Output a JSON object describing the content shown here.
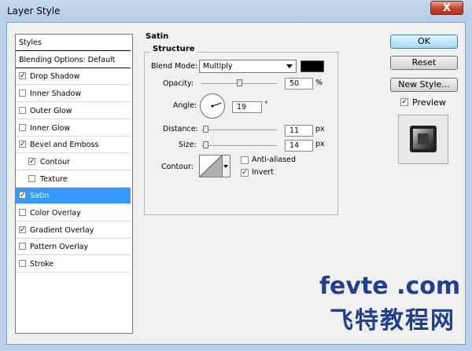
{
  "window": {
    "title": "Layer Style",
    "close_glyph": "X"
  },
  "styles_list": [
    {
      "label": "Styles",
      "type": "header"
    },
    {
      "label": "Blending Options: Default",
      "type": "header"
    },
    {
      "label": "Drop Shadow",
      "checked": true
    },
    {
      "label": "Inner Shadow",
      "checked": false
    },
    {
      "label": "Outer Glow",
      "checked": false
    },
    {
      "label": "Inner Glow",
      "checked": false
    },
    {
      "label": "Bevel and Emboss",
      "checked": true
    },
    {
      "label": "Contour",
      "checked": true,
      "indent": true
    },
    {
      "label": "Texture",
      "checked": false,
      "indent": true
    },
    {
      "label": "Satin",
      "checked": true,
      "selected": true
    },
    {
      "label": "Color Overlay",
      "checked": false
    },
    {
      "label": "Gradient Overlay",
      "checked": true
    },
    {
      "label": "Pattern Overlay",
      "checked": false
    },
    {
      "label": "Stroke",
      "checked": false
    }
  ],
  "panel": {
    "section_title": "Satin",
    "group_title": "Structure",
    "blend_mode_label": "Blend Mode:",
    "blend_mode_value": "Multiply",
    "blend_color": "#000000",
    "opacity_label": "Opacity:",
    "opacity_value": "50",
    "opacity_unit": "%",
    "opacity_level": 0.5,
    "angle_label": "Angle:",
    "angle_value": "19",
    "angle_unit": "°",
    "distance_label": "Distance:",
    "distance_value": "11",
    "distance_unit": "px",
    "distance_level": 0.05,
    "size_label": "Size:",
    "size_value": "14",
    "size_unit": "px",
    "size_level": 0.05,
    "contour_label": "Contour:",
    "anti_aliased_label": "Anti-aliased",
    "anti_aliased_checked": false,
    "invert_label": "Invert",
    "invert_checked": true
  },
  "buttons": {
    "ok": "OK",
    "reset": "Reset",
    "new_style": "New Style...",
    "preview_label": "Preview",
    "preview_checked": true
  },
  "watermark": {
    "line1": "fevte .com",
    "line2": "飞特教程网"
  }
}
